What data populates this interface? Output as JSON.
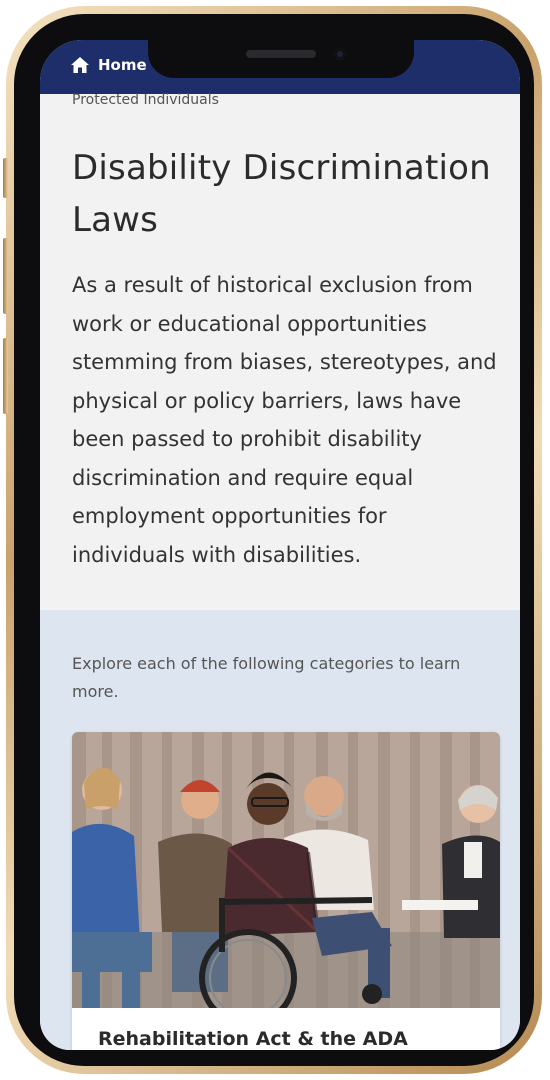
{
  "header": {
    "home_label": "Home",
    "home_icon": "home-icon",
    "bg_color": "#1d2e6b"
  },
  "breadcrumb": "Protected Individuals",
  "page": {
    "title": "Disability Discrimination Laws",
    "lead": "As a result of historical exclusion from work or educational opportunities stemming from biases, stereotypes, and physical or policy barriers, laws have been passed to prohibit disability discrimination and require equal employment opportunities for individuals with disabilities."
  },
  "explore": {
    "text": "Explore each of the following categories to learn more.",
    "cards": [
      {
        "title": "Rehabilitation Act & the ADA"
      }
    ]
  }
}
